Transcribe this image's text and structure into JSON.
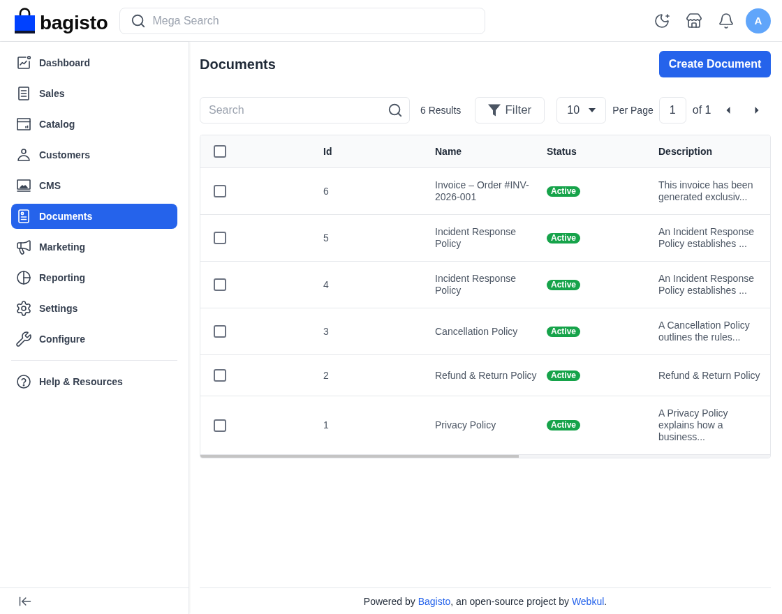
{
  "header": {
    "logo": "bagisto",
    "search": {
      "placeholder": "Mega Search"
    },
    "avatar": "A"
  },
  "sidebar": {
    "items": [
      {
        "label": "Dashboard",
        "selected": false
      },
      {
        "label": "Sales",
        "selected": false
      },
      {
        "label": "Catalog",
        "selected": false
      },
      {
        "label": "Customers",
        "selected": false
      },
      {
        "label": "CMS",
        "selected": false
      },
      {
        "label": "Documents",
        "selected": true
      },
      {
        "label": "Marketing",
        "selected": false
      },
      {
        "label": "Reporting",
        "selected": false
      },
      {
        "label": "Settings",
        "selected": false
      },
      {
        "label": "Configure",
        "selected": false
      }
    ],
    "help": {
      "label": "Help & Resources"
    }
  },
  "page": {
    "title": "Documents",
    "create_button": "Create Document"
  },
  "toolbar": {
    "search": {
      "placeholder": "Search"
    },
    "results": "6 Results",
    "filter": "Filter",
    "per_page": {
      "value": "10",
      "label": "Per Page"
    },
    "pagination": {
      "page": "1",
      "total": "of 1"
    }
  },
  "table": {
    "select_all": {
      "checked": false
    },
    "columns": [
      "Id",
      "Name",
      "Status",
      "Description"
    ],
    "rows": [
      {
        "checked": false,
        "id": "6",
        "name": "Invoice – Order #INV-2026-001",
        "status": "Active",
        "description": "This invoice has been generated exclusiv..."
      },
      {
        "checked": false,
        "id": "5",
        "name": "Incident Response Policy",
        "status": "Active",
        "description": "An Incident Response Policy establishes ..."
      },
      {
        "checked": false,
        "id": "4",
        "name": "Incident Response Policy",
        "status": "Active",
        "description": "An Incident Response Policy establishes ..."
      },
      {
        "checked": false,
        "id": "3",
        "name": "Cancellation Policy",
        "status": "Active",
        "description": "A Cancellation Policy outlines the rules..."
      },
      {
        "checked": false,
        "id": "2",
        "name": "Refund & Return Policy",
        "status": "Active",
        "description": "Refund & Return Policy"
      },
      {
        "checked": false,
        "id": "1",
        "name": "Privacy Policy",
        "status": "Active",
        "description": "A Privacy Policy explains how a business..."
      }
    ]
  },
  "footer": {
    "parts": [
      {
        "kind": "text",
        "text": "Powered by "
      },
      {
        "kind": "link",
        "text": "Bagisto"
      },
      {
        "kind": "text",
        "text": ", an open-source project by "
      },
      {
        "kind": "link",
        "text": "Webkul"
      },
      {
        "kind": "text",
        "text": "."
      }
    ]
  }
}
